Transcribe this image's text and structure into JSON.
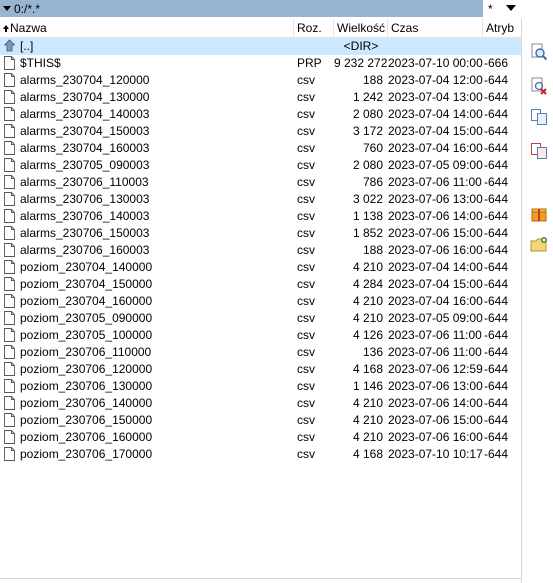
{
  "path": {
    "label": "0:/*.*"
  },
  "filter": {
    "label": "*"
  },
  "header": {
    "name": "Nazwa",
    "ext": "Roz.",
    "size": "Wielkość",
    "time": "Czas",
    "attr": "Atryb"
  },
  "up_row": {
    "name": "[..]",
    "size": "<DIR>"
  },
  "files": [
    {
      "name": "$THIS$",
      "ext": "PRP",
      "size": "9 232 272",
      "time": "2023-07-10 00:00",
      "attr": "-666"
    },
    {
      "name": "alarms_230704_120000",
      "ext": "csv",
      "size": "188",
      "time": "2023-07-04 12:00",
      "attr": "-644"
    },
    {
      "name": "alarms_230704_130000",
      "ext": "csv",
      "size": "1 242",
      "time": "2023-07-04 13:00",
      "attr": "-644"
    },
    {
      "name": "alarms_230704_140003",
      "ext": "csv",
      "size": "2 080",
      "time": "2023-07-04 14:00",
      "attr": "-644"
    },
    {
      "name": "alarms_230704_150003",
      "ext": "csv",
      "size": "3 172",
      "time": "2023-07-04 15:00",
      "attr": "-644"
    },
    {
      "name": "alarms_230704_160003",
      "ext": "csv",
      "size": "760",
      "time": "2023-07-04 16:00",
      "attr": "-644"
    },
    {
      "name": "alarms_230705_090003",
      "ext": "csv",
      "size": "2 080",
      "time": "2023-07-05 09:00",
      "attr": "-644"
    },
    {
      "name": "alarms_230706_110003",
      "ext": "csv",
      "size": "786",
      "time": "2023-07-06 11:00",
      "attr": "-644"
    },
    {
      "name": "alarms_230706_130003",
      "ext": "csv",
      "size": "3 022",
      "time": "2023-07-06 13:00",
      "attr": "-644"
    },
    {
      "name": "alarms_230706_140003",
      "ext": "csv",
      "size": "1 138",
      "time": "2023-07-06 14:00",
      "attr": "-644"
    },
    {
      "name": "alarms_230706_150003",
      "ext": "csv",
      "size": "1 852",
      "time": "2023-07-06 15:00",
      "attr": "-644"
    },
    {
      "name": "alarms_230706_160003",
      "ext": "csv",
      "size": "188",
      "time": "2023-07-06 16:00",
      "attr": "-644"
    },
    {
      "name": "poziom_230704_140000",
      "ext": "csv",
      "size": "4 210",
      "time": "2023-07-04 14:00",
      "attr": "-644"
    },
    {
      "name": "poziom_230704_150000",
      "ext": "csv",
      "size": "4 284",
      "time": "2023-07-04 15:00",
      "attr": "-644"
    },
    {
      "name": "poziom_230704_160000",
      "ext": "csv",
      "size": "4 210",
      "time": "2023-07-04 16:00",
      "attr": "-644"
    },
    {
      "name": "poziom_230705_090000",
      "ext": "csv",
      "size": "4 210",
      "time": "2023-07-05 09:00",
      "attr": "-644"
    },
    {
      "name": "poziom_230705_100000",
      "ext": "csv",
      "size": "4 126",
      "time": "2023-07-06 11:00",
      "attr": "-644"
    },
    {
      "name": "poziom_230706_110000",
      "ext": "csv",
      "size": "136",
      "time": "2023-07-06 11:00",
      "attr": "-644"
    },
    {
      "name": "poziom_230706_120000",
      "ext": "csv",
      "size": "4 168",
      "time": "2023-07-06 12:59",
      "attr": "-644"
    },
    {
      "name": "poziom_230706_130000",
      "ext": "csv",
      "size": "1 146",
      "time": "2023-07-06 13:00",
      "attr": "-644"
    },
    {
      "name": "poziom_230706_140000",
      "ext": "csv",
      "size": "4 210",
      "time": "2023-07-06 14:00",
      "attr": "-644"
    },
    {
      "name": "poziom_230706_150000",
      "ext": "csv",
      "size": "4 210",
      "time": "2023-07-06 15:00",
      "attr": "-644"
    },
    {
      "name": "poziom_230706_160000",
      "ext": "csv",
      "size": "4 210",
      "time": "2023-07-06 16:00",
      "attr": "-644"
    },
    {
      "name": "poziom_230706_170000",
      "ext": "csv",
      "size": "4 168",
      "time": "2023-07-10 10:17",
      "attr": "-644"
    }
  ],
  "sidebar": {
    "tools": [
      {
        "icon": "find-files-icon"
      },
      {
        "icon": "delete-search-icon"
      },
      {
        "icon": "copy-icon"
      },
      {
        "icon": "compare-icon"
      },
      {
        "icon": "pack-icon"
      },
      {
        "icon": "new-folder-icon"
      }
    ]
  },
  "colors": {
    "path_bar": "#99b4d1",
    "selected_row": "#cce8ff"
  }
}
